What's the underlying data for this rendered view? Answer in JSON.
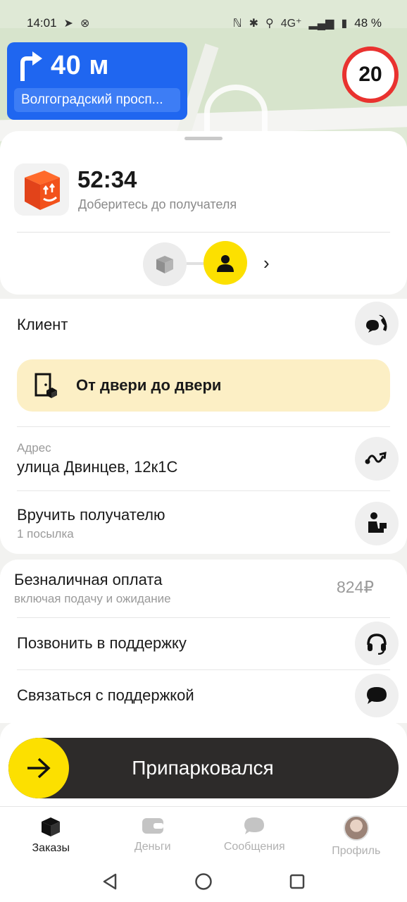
{
  "status_bar": {
    "time": "14:01",
    "network": "4G⁺",
    "battery": "48 %"
  },
  "navigation": {
    "distance": "40 м",
    "street": "Волгоградский просп..."
  },
  "speed_limit": "20",
  "order": {
    "timer": "52:34",
    "instruction": "Доберитесь до получателя"
  },
  "client": {
    "label": "Клиент"
  },
  "door_banner": {
    "label": "От двери до двери"
  },
  "address": {
    "caption": "Адрес",
    "value": "улица Двинцев, 12к1С"
  },
  "handover": {
    "label": "Вручить получателю",
    "sub": "1 посылка"
  },
  "payment": {
    "label": "Безналичная оплата",
    "sub": "включая подачу и ожидание",
    "price": "824₽"
  },
  "support": {
    "call_label": "Позвонить в поддержку",
    "chat_label": "Связаться с поддержкой"
  },
  "action_button": {
    "label": "Припарковался"
  },
  "tabs": [
    {
      "label": "Заказы",
      "icon": "box-icon",
      "active": true
    },
    {
      "label": "Деньги",
      "icon": "wallet-icon",
      "active": false
    },
    {
      "label": "Сообщения",
      "icon": "chat-bubble-icon",
      "active": false
    },
    {
      "label": "Профиль",
      "icon": "avatar",
      "active": false
    }
  ],
  "colors": {
    "accent_yellow": "#fce000",
    "nav_blue": "#1f66f0",
    "speed_red": "#e9322f",
    "banner_cream": "#fcefc5"
  }
}
